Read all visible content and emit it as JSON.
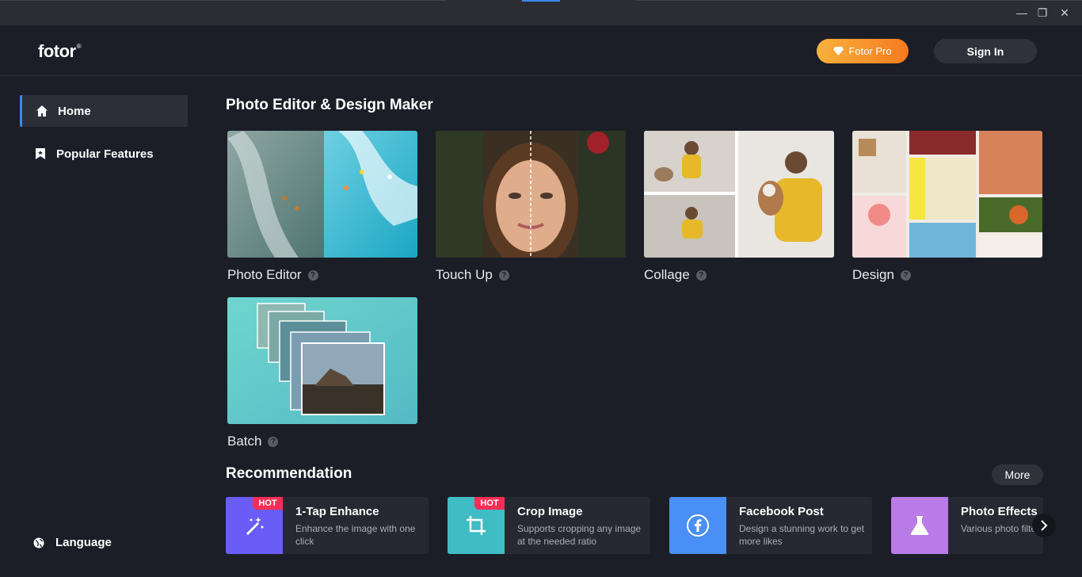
{
  "window": {
    "minimize_glyph": "—",
    "restore_glyph": "❐",
    "close_glyph": "✕"
  },
  "header": {
    "logo": "fotor",
    "logo_mark": "®",
    "pro_button": "Fotor Pro",
    "signin_button": "Sign In"
  },
  "sidebar": {
    "items": [
      {
        "label": "Home",
        "icon": "home-icon",
        "active": true
      },
      {
        "label": "Popular Features",
        "icon": "bookmark-icon",
        "active": false
      }
    ],
    "language": "Language"
  },
  "main": {
    "section_title": "Photo Editor & Design Maker",
    "cards": [
      {
        "label": "Photo Editor"
      },
      {
        "label": "Touch Up"
      },
      {
        "label": "Collage"
      },
      {
        "label": "Design"
      },
      {
        "label": "Batch"
      }
    ]
  },
  "recommendation": {
    "title": "Recommendation",
    "more": "More",
    "items": [
      {
        "title": "1-Tap Enhance",
        "desc": "Enhance the image with one click",
        "badge": "HOT",
        "icon": "magic-wand-icon",
        "color": "#6a5cf6"
      },
      {
        "title": "Crop Image",
        "desc": "Supports cropping any image at the needed ratio",
        "badge": "HOT",
        "icon": "crop-icon",
        "color": "#3fbcc4"
      },
      {
        "title": "Facebook Post",
        "desc": "Design a stunning work to get more likes",
        "badge": "",
        "icon": "facebook-icon",
        "color": "#4a8ff5"
      },
      {
        "title": "Photo Effects",
        "desc": "Various photo filters at your disposal",
        "badge": "",
        "icon": "flask-icon",
        "color": "#b97be6"
      }
    ]
  },
  "colors": {
    "accent": "#3a86ff",
    "background": "#1b1e26",
    "pro_gradient_start": "#f8b13c",
    "pro_gradient_end": "#f67a1f",
    "hot_badge": "#ff2d55"
  }
}
